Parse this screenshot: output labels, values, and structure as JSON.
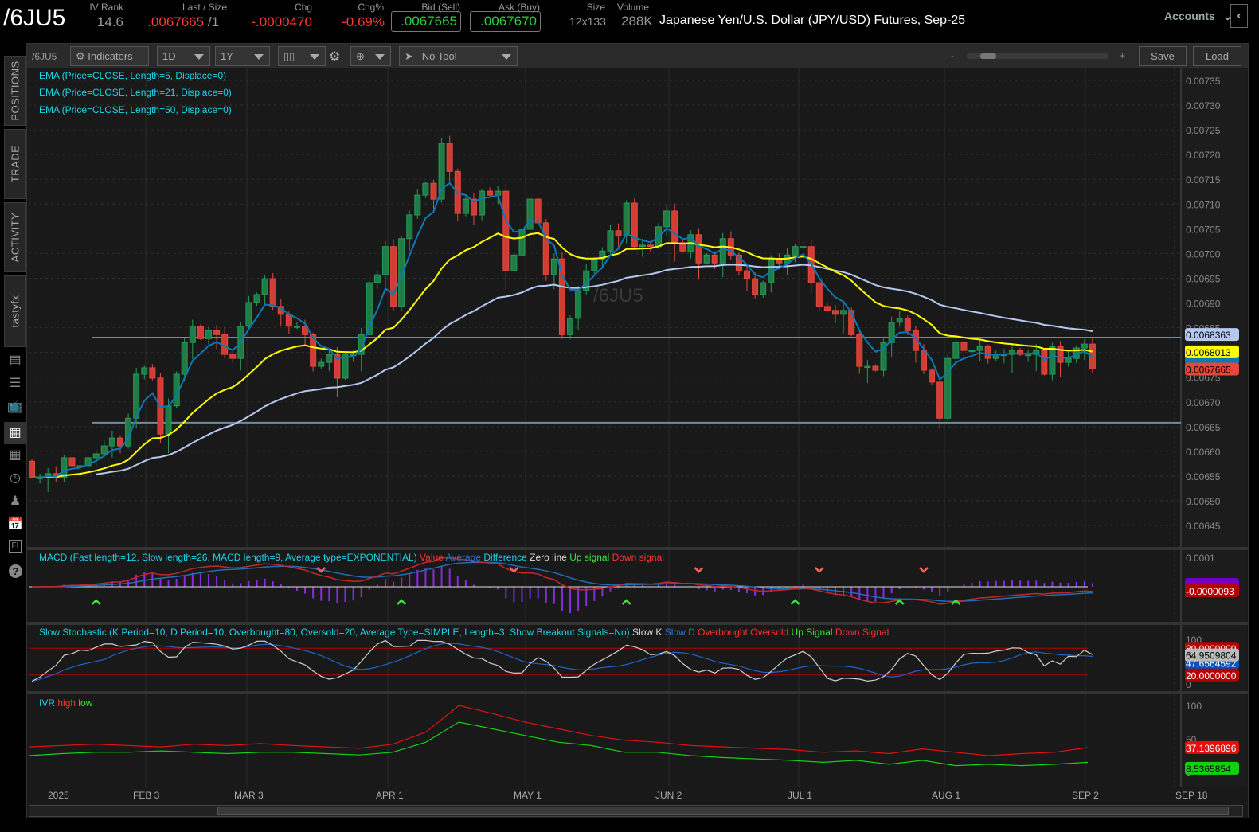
{
  "header": {
    "symbol": "/6JU5",
    "iv_rank_label": "IV Rank",
    "iv_rank": "14.6",
    "last_label": "Last / Size",
    "last": ".0067665",
    "last_size": " /1",
    "chg_label": "Chg",
    "chg": "-.0000470",
    "chgpct_label": "Chg%",
    "chgpct": "-0.69%",
    "bid_label": "Bid (Sell)",
    "bid": ".0067665",
    "ask_label": "Ask (Buy)",
    "ask": ".0067670",
    "size_label": "Size",
    "size": "12x133",
    "volume_label": "Volume",
    "volume": "288K",
    "title": "Japanese Yen/U.S. Dollar (JPY/USD) Futures, Sep-25",
    "accounts": "Accounts"
  },
  "sidebar": {
    "tabs": [
      "POSITIONS",
      "TRADE",
      "ACTIVITY",
      "tastyfx"
    ]
  },
  "toolbar": {
    "symbol": "/6JU5",
    "indicators": "Indicators",
    "interval": "1D",
    "range": "1Y",
    "tool": "No Tool",
    "zoom_minus": "-",
    "zoom_plus": "+",
    "save": "Save",
    "load": "Load"
  },
  "legends": {
    "ema5": "EMA (Price=CLOSE, Length=5, Displace=0)",
    "ema21": "EMA (Price=CLOSE, Length=21, Displace=0)",
    "ema50": "EMA (Price=CLOSE, Length=50, Displace=0)",
    "macd": {
      "title": "MACD (Fast length=12, Slow length=26, MACD length=9, Average type=EXPONENTIAL)",
      "value": "Value",
      "average": "Average",
      "difference": "Difference",
      "zero": "Zero line",
      "up": "Up signal",
      "down": "Down signal"
    },
    "stoch": {
      "title": "Slow Stochastic (K Period=10, D Period=10, Overbought=80, Oversold=20, Average Type=SIMPLE, Length=3, Show Breakout Signals=No)",
      "k": "Slow K",
      "d": "Slow D",
      "ob": "Overbought",
      "os": "Oversold",
      "up": "Up Signal",
      "down": "Down Signal"
    },
    "ivr": {
      "title": "IVR",
      "high": "high",
      "low": "low"
    }
  },
  "watermark": "/6JU5",
  "colors": {
    "up": "#1e7d46",
    "down": "#d23c34",
    "ema5": "#0a78b4",
    "ema21": "#ffff00",
    "ema50": "#b4c8f0",
    "hline": "#6e8ca0"
  },
  "chart_data": {
    "type": "candlestick",
    "price_ticks": [
      0.00735,
      0.0073,
      0.00725,
      0.0072,
      0.00715,
      0.0071,
      0.00705,
      0.007,
      0.00695,
      0.0069,
      0.00685,
      0.0068,
      0.00675,
      0.0067,
      0.00665,
      0.0066,
      0.00655,
      0.0065,
      0.00645
    ],
    "ylim": [
      0.00642,
      0.00738
    ],
    "x_labels": [
      "2025",
      "FEB 3",
      "MAR 3",
      "APR 1",
      "MAY 1",
      "JUN 2",
      "JUL 1",
      "AUG 1",
      "SEP 2",
      "SEP 18"
    ],
    "first_open": 0.00658,
    "close": [
      0.006547,
      0.006547,
      0.006555,
      0.006547,
      0.006587,
      0.006571,
      0.006571,
      0.006587,
      0.006595,
      0.006611,
      0.006627,
      0.006611,
      0.006667,
      0.006756,
      0.006769,
      0.006748,
      0.006635,
      0.006692,
      0.006756,
      0.00682,
      0.006853,
      0.006828,
      0.006844,
      0.006836,
      0.006796,
      0.006788,
      0.006853,
      0.006901,
      0.006917,
      0.006949,
      0.006893,
      0.006877,
      0.006853,
      0.006853,
      0.006836,
      0.006772,
      0.00678,
      0.006796,
      0.006748,
      0.006796,
      0.006796,
      0.006836,
      0.006941,
      0.006957,
      0.007014,
      0.006893,
      0.00703,
      0.007078,
      0.007118,
      0.007142,
      0.00711,
      0.007223,
      0.007166,
      0.007081,
      0.00711,
      0.007078,
      0.007126,
      0.007118,
      0.007126,
      0.006965,
      0.006997,
      0.007049,
      0.00711,
      0.007062,
      0.006957,
      0.006989,
      0.006836,
      0.006869,
      0.006925,
      0.006965,
      0.006989,
      0.007005,
      0.007046,
      0.007036,
      0.007102,
      0.007014,
      0.007017,
      0.007014,
      0.007054,
      0.007086,
      0.007022,
      0.007005,
      0.007038,
      0.006981,
      0.006997,
      0.006981,
      0.00703,
      0.006997,
      0.006965,
      0.006949,
      0.006917,
      0.006941,
      0.006989,
      0.006981,
      0.006997,
      0.007014,
      0.007014,
      0.006941,
      0.006893,
      0.006885,
      0.006877,
      0.006885,
      0.006836,
      0.006772,
      0.006772,
      0.006764,
      0.00682,
      0.006861,
      0.006869,
      0.006844,
      0.006804,
      0.006764,
      0.00674,
      0.006667,
      0.006788,
      0.00682,
      0.006804,
      0.006804,
      0.006812,
      0.006788,
      0.006796,
      0.006796,
      0.006804,
      0.006796,
      0.006796,
      0.006804,
      0.006756,
      0.006812,
      0.00678,
      0.006788,
      0.006809,
      0.006817,
      0.0067665
    ],
    "horizontal_lines": [
      0.00683,
      0.006658
    ],
    "price_labels": {
      "ema50": "0.0068363",
      "ema21": "0.0068013",
      "last": "0.0067665"
    },
    "macd": {
      "top_tick": "0.0001",
      "value_label": "-0.0000093",
      "up_signal_bars": [
        8,
        46,
        74,
        95,
        108,
        115
      ],
      "down_signal_bars": [
        36,
        60,
        83,
        98,
        111
      ]
    },
    "stoch": {
      "ticks": [
        "100",
        "0"
      ],
      "overbought": 80,
      "oversold": 20,
      "labels": [
        "80.0000000",
        "64.9509804",
        "47.6564592",
        "20.0000000"
      ]
    },
    "ivr": {
      "ticks": [
        "100",
        "50",
        "0"
      ],
      "high": [
        38,
        40,
        42,
        40,
        38,
        42,
        40,
        43,
        40,
        38,
        36,
        42,
        60,
        100,
        88,
        75,
        65,
        55,
        48,
        45,
        40,
        38,
        36,
        34,
        30,
        32,
        28,
        35,
        30,
        25,
        28,
        30,
        37
      ],
      "low": [
        25,
        28,
        30,
        30,
        32,
        30,
        28,
        30,
        30,
        28,
        26,
        30,
        45,
        75,
        65,
        55,
        45,
        40,
        30,
        30,
        25,
        22,
        20,
        18,
        15,
        18,
        12,
        18,
        10,
        12,
        10,
        12,
        15
      ],
      "labels": [
        "37.1396896",
        "8.5365854"
      ]
    }
  }
}
